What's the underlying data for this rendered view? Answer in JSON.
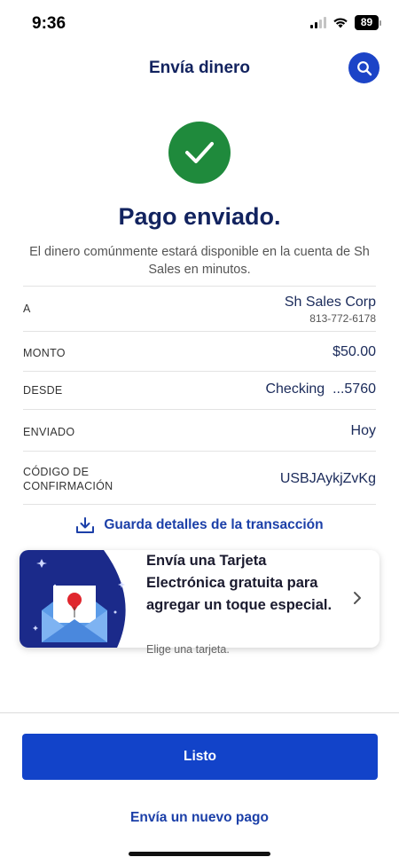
{
  "status_bar": {
    "time": "9:36",
    "battery": "89",
    "icons": [
      "signal-icon",
      "wifi-icon",
      "battery-icon"
    ]
  },
  "header": {
    "title": "Envía dinero",
    "search_icon": "search-icon"
  },
  "confirmation": {
    "icon": "check-icon",
    "title": "Pago enviado.",
    "description": "El dinero comúnmente estará disponible en la cuenta de Sh Sales en minutos."
  },
  "details": {
    "to": {
      "label": "A",
      "value": "Sh Sales Corp",
      "sub": "813-772-6178"
    },
    "amount": {
      "label": "MONTO",
      "value": "$50.00"
    },
    "from": {
      "label": "DESDE",
      "value": "Checking  ...5760"
    },
    "sent": {
      "label": "ENVIADO",
      "value": "Hoy"
    },
    "confirmation_code": {
      "label": "CÓDIGO DE CONFIRMACIÓN",
      "value": "USBJAykjZvKg"
    }
  },
  "save_details": {
    "icon": "download-icon",
    "label": "Guarda detalles de la transacción"
  },
  "ecard_promo": {
    "icon": "envelope-icon",
    "text": "Envía una Tarjeta Electrónica gratuita para agregar un toque especial.",
    "subtext": "Elige una tarjeta.",
    "chevron": "chevron-right-icon"
  },
  "actions": {
    "done_label": "Listo",
    "new_payment_label": "Envía un nuevo pago"
  },
  "colors": {
    "brand_navy": "#12235f",
    "primary_blue": "#1243c9",
    "success_green": "#1f8a3c"
  }
}
